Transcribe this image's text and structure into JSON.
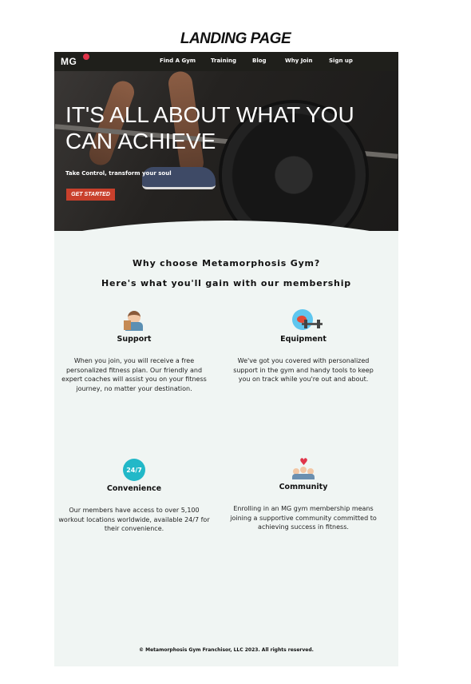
{
  "page_title": "LANDING PAGE",
  "nav": {
    "logo": "MG",
    "items": [
      "Find A Gym",
      "Training",
      "Blog",
      "Why Join",
      "Sign up"
    ]
  },
  "hero": {
    "headline": "IT'S ALL ABOUT WHAT YOU CAN ACHIEVE",
    "subtitle": "Take Control, transform your soul",
    "cta": "GET STARTED"
  },
  "section": {
    "heading": "Why choose Metamorphosis Gym?",
    "subheading": "Here's what you'll gain with our membership"
  },
  "features": [
    {
      "icon": "coach-icon",
      "title": "Support",
      "text": "When you join, you will receive a free personalized fitness plan. Our friendly and expert coaches will assist you on your fitness journey, no matter your destination."
    },
    {
      "icon": "equipment-icon",
      "title": "Equipment",
      "text": "We've got you covered with personalized support in the gym and handy tools to keep you on track while you're out and about."
    },
    {
      "icon": "clock-24-7-icon",
      "icon_text": "24/7",
      "title": "Convenience",
      "text": "Our members have access to over 5,100 workout locations worldwide, available 24/7 for their convenience."
    },
    {
      "icon": "community-icon",
      "title": "Community",
      "text": "Enrolling in an MG gym membership means joining a supportive community committed to achieving success in fitness."
    }
  ],
  "footer": "© Metamorphosis Gym Franchisor, LLC 2023. All rights reserved.",
  "colors": {
    "accent": "#c9402c",
    "nav_bg": "#1f1f1b",
    "content_bg": "#f0f5f3",
    "teal": "#22b8c8"
  }
}
